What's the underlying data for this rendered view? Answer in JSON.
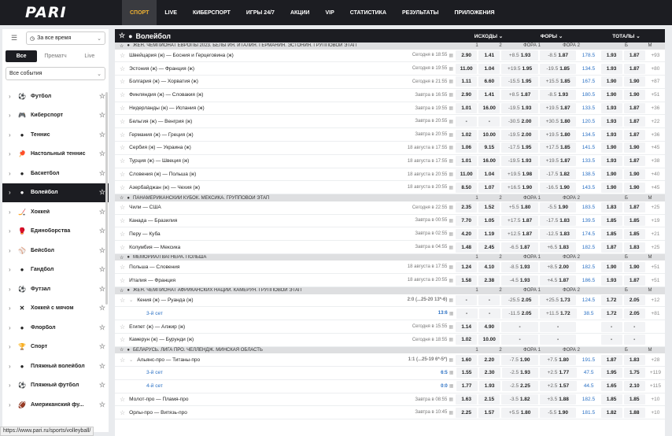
{
  "logo": "PARI",
  "nav": [
    "СПОРТ",
    "LIVE",
    "КИБЕРСПОРТ",
    "ИГРЫ 24/7",
    "АКЦИИ",
    "VIP",
    "СТАТИСТИКА",
    "РЕЗУЛЬТАТЫ",
    "ПРИЛОЖЕНИЯ"
  ],
  "sidebar": {
    "time": "За все время",
    "tabs": [
      "Все",
      "Прематч",
      "Live"
    ],
    "events": "Все события",
    "sports": [
      {
        "name": "Футбол",
        "icon": "⚽"
      },
      {
        "name": "Киберспорт",
        "icon": "🎮"
      },
      {
        "name": "Теннис",
        "icon": "●"
      },
      {
        "name": "Настольный теннис",
        "icon": "🏓"
      },
      {
        "name": "Баскетбол",
        "icon": "●"
      },
      {
        "name": "Волейбол",
        "icon": "●"
      },
      {
        "name": "Хоккей",
        "icon": "🏒"
      },
      {
        "name": "Единоборства",
        "icon": "🥊"
      },
      {
        "name": "Бейсбол",
        "icon": "⚾"
      },
      {
        "name": "Гандбол",
        "icon": "●"
      },
      {
        "name": "Футзал",
        "icon": "⚽"
      },
      {
        "name": "Хоккей с мячом",
        "icon": "✕"
      },
      {
        "name": "Флорбол",
        "icon": "●"
      },
      {
        "name": "Спорт",
        "icon": "🏆"
      },
      {
        "name": "Пляжный волейбол",
        "icon": "●"
      },
      {
        "name": "Пляжный футбол",
        "icon": "⚽"
      },
      {
        "name": "Американский фу...",
        "icon": "🏈"
      }
    ],
    "active": "Волейбол"
  },
  "main": {
    "title": "Волейбол",
    "col_groups": [
      "ИСХОДЫ",
      "ФОРЫ",
      "ТОТАЛЫ"
    ],
    "sub_cols": [
      "1",
      "2",
      "ФОРА 1",
      "ФОРА 2",
      "Б",
      "М"
    ],
    "leagues": [
      {
        "name": "ЖЕН. ЧЕМПИОНАТ ЕВРОПЫ 2023. БЕЛЬГИЯ. ИТАЛИЯ. ГЕРМАНИЯ. ЭСТОНИЯ. ГРУППОВОЙ ЭТАП",
        "rows": [
          {
            "teams": "Швейцария (ж) — Босния и Герцеговина (ж)",
            "time": "Сегодня в 18:55",
            "o1": "2.90",
            "o2": "1.41",
            "f1h": "+8.5",
            "f1": "1.93",
            "f2h": "-8.5",
            "f2": "1.87",
            "th": "178.5",
            "b": "1.93",
            "m": "1.87",
            "more": "+93"
          },
          {
            "teams": "Эстония (ж) — Франция (ж)",
            "time": "Сегодня в 19:55",
            "o1": "11.00",
            "o2": "1.04",
            "f1h": "+19.5",
            "f1": "1.95",
            "f2h": "-19.5",
            "f2": "1.85",
            "th": "134.5",
            "b": "1.93",
            "m": "1.87",
            "more": "+80"
          },
          {
            "teams": "Болгария (ж) — Хорватия (ж)",
            "time": "Сегодня в 21:55",
            "o1": "1.11",
            "o2": "6.60",
            "f1h": "-15.5",
            "f1": "1.95",
            "f2h": "+15.5",
            "f2": "1.85",
            "th": "167.5",
            "b": "1.90",
            "m": "1.90",
            "more": "+87"
          },
          {
            "teams": "Финляндия (ж) — Словакия (ж)",
            "time": "Завтра в 16:55",
            "o1": "2.90",
            "o2": "1.41",
            "f1h": "+8.5",
            "f1": "1.87",
            "f2h": "-8.5",
            "f2": "1.93",
            "th": "180.5",
            "b": "1.90",
            "m": "1.90",
            "more": "+51"
          },
          {
            "teams": "Нидерланды (ж) — Испания (ж)",
            "time": "Завтра в 19:55",
            "o1": "1.01",
            "o2": "16.00",
            "f1h": "-19.5",
            "f1": "1.93",
            "f2h": "+19.5",
            "f2": "1.87",
            "th": "133.5",
            "b": "1.93",
            "m": "1.87",
            "more": "+36"
          },
          {
            "teams": "Бельгия (ж) — Венгрия (ж)",
            "time": "Завтра в 20:55",
            "o1": "-",
            "o2": "-",
            "f1h": "-30.5",
            "f1": "2.00",
            "f2h": "+30.5",
            "f2": "1.80",
            "th": "120.5",
            "b": "1.93",
            "m": "1.87",
            "more": "+22"
          },
          {
            "teams": "Германия (ж) — Греция (ж)",
            "time": "Завтра в 20:55",
            "o1": "1.02",
            "o2": "10.00",
            "f1h": "-19.5",
            "f1": "2.00",
            "f2h": "+19.5",
            "f2": "1.80",
            "th": "134.5",
            "b": "1.93",
            "m": "1.87",
            "more": "+36"
          },
          {
            "teams": "Сербия (ж) — Украина (ж)",
            "time": "18 августа в 17:55",
            "o1": "1.06",
            "o2": "9.15",
            "f1h": "-17.5",
            "f1": "1.95",
            "f2h": "+17.5",
            "f2": "1.85",
            "th": "141.5",
            "b": "1.90",
            "m": "1.90",
            "more": "+45"
          },
          {
            "teams": "Турция (ж) — Швеция (ж)",
            "time": "18 августа в 17:55",
            "o1": "1.01",
            "o2": "16.00",
            "f1h": "-19.5",
            "f1": "1.93",
            "f2h": "+19.5",
            "f2": "1.87",
            "th": "133.5",
            "b": "1.93",
            "m": "1.87",
            "more": "+38"
          },
          {
            "teams": "Словения (ж) — Польша (ж)",
            "time": "18 августа в 20:55",
            "o1": "11.00",
            "o2": "1.04",
            "f1h": "+19.5",
            "f1": "1.98",
            "f2h": "-17.5",
            "f2": "1.82",
            "th": "138.5",
            "b": "1.90",
            "m": "1.90",
            "more": "+40"
          },
          {
            "teams": "Азербайджан (ж) — Чехия (ж)",
            "time": "18 августа в 20:55",
            "o1": "8.50",
            "o2": "1.07",
            "f1h": "+16.5",
            "f1": "1.90",
            "f2h": "-16.5",
            "f2": "1.90",
            "th": "143.5",
            "b": "1.90",
            "m": "1.90",
            "more": "+45"
          }
        ]
      },
      {
        "name": "ПАНАМЕРИКАНСКИЙ КУБОК. МЕКСИКА. ГРУППОВОЙ ЭТАП",
        "rows": [
          {
            "teams": "Чили — США",
            "time": "Сегодня в 22:55",
            "o1": "2.35",
            "o2": "1.52",
            "f1h": "+5.5",
            "f1": "1.80",
            "f2h": "-5.5",
            "f2": "1.90",
            "th": "183.5",
            "b": "1.83",
            "m": "1.87",
            "more": "+25"
          },
          {
            "teams": "Канада — Бразилия",
            "time": "Завтра в 00:55",
            "o1": "7.70",
            "o2": "1.05",
            "f1h": "+17.5",
            "f1": "1.87",
            "f2h": "-17.5",
            "f2": "1.83",
            "th": "139.5",
            "b": "1.85",
            "m": "1.85",
            "more": "+19"
          },
          {
            "teams": "Перу — Куба",
            "time": "Завтра в 02:55",
            "o1": "4.20",
            "o2": "1.19",
            "f1h": "+12.5",
            "f1": "1.87",
            "f2h": "-12.5",
            "f2": "1.83",
            "th": "174.5",
            "b": "1.85",
            "m": "1.85",
            "more": "+21"
          },
          {
            "teams": "Колумбия — Мексика",
            "time": "Завтра в 04:55",
            "o1": "1.48",
            "o2": "2.45",
            "f1h": "-6.5",
            "f1": "1.87",
            "f2h": "+6.5",
            "f2": "1.83",
            "th": "182.5",
            "b": "1.87",
            "m": "1.83",
            "more": "+25"
          }
        ]
      },
      {
        "name": "МЕМОРИАЛ ВАГНЕРА. ПОЛЬША",
        "rows": [
          {
            "teams": "Польша — Словения",
            "time": "18 августа в 17:55",
            "o1": "1.24",
            "o2": "4.10",
            "f1h": "-8.5",
            "f1": "1.93",
            "f2h": "+8.5",
            "f2": "2.00",
            "th": "182.5",
            "b": "1.90",
            "m": "1.90",
            "more": "+51"
          },
          {
            "teams": "Италия — Франция",
            "time": "18 августа в 20:55",
            "o1": "1.58",
            "o2": "2.38",
            "f1h": "-4.5",
            "f1": "1.93",
            "f2h": "+4.5",
            "f2": "1.87",
            "th": "186.5",
            "b": "1.93",
            "m": "1.87",
            "more": "+51"
          }
        ]
      },
      {
        "name": "ЖЕН. ЧЕМПИОНАТ АФРИКАНСКИХ НАЦИЙ. КАМЕРУН. ГРУППОВОЙ ЭТАП",
        "rows": [
          {
            "teams": "Кения (ж) — Руанда (ж)",
            "time": "2:0 (...25-20 13*-6)",
            "o1": "-",
            "o2": "-",
            "f1h": "-25.5",
            "f1": "2.05",
            "f2h": "+25.5",
            "f2": "1.73",
            "th": "124.5",
            "b": "1.72",
            "m": "2.05",
            "more": "+12",
            "live": true
          },
          {
            "teams": "3-й сет",
            "time": "13:6",
            "o1": "-",
            "o2": "-",
            "f1h": "-11.5",
            "f1": "2.05",
            "f2h": "+11.5",
            "f2": "1.72",
            "th": "38.5",
            "b": "1.72",
            "m": "2.05",
            "more": "+81",
            "sub": true
          },
          {
            "teams": "Египет (ж) — Алжир (ж)",
            "time": "Сегодня в 15:55",
            "o1": "1.14",
            "o2": "4.90",
            "f1h": "",
            "f1": "-",
            "f2h": "",
            "f2": "-",
            "th": "",
            "b": "-",
            "m": "-",
            "more": ""
          },
          {
            "teams": "Камерун (ж) — Бурунди (ж)",
            "time": "Сегодня в 18:55",
            "o1": "1.02",
            "o2": "10.00",
            "f1h": "",
            "f1": "-",
            "f2h": "",
            "f2": "-",
            "th": "",
            "b": "-",
            "m": "-",
            "more": ""
          }
        ]
      },
      {
        "name": "БЕЛАРУСЬ. ЛИГА ПРО. ЧЕЛЛЕНДЖ. МИНСКАЯ ОБЛАСТЬ",
        "rows": [
          {
            "teams": "Альянс-про — Титаны-про",
            "time": "1:1 (...25-19 6*-5*)",
            "o1": "1.60",
            "o2": "2.20",
            "f1h": "-7.5",
            "f1": "1.90",
            "f2h": "+7.5",
            "f2": "1.80",
            "th": "191.5",
            "b": "1.87",
            "m": "1.83",
            "more": "+28",
            "live": true
          },
          {
            "teams": "3-й сет",
            "time": "6:5",
            "o1": "1.55",
            "o2": "2.30",
            "f1h": "-2.5",
            "f1": "1.93",
            "f2h": "+2.5",
            "f2": "1.77",
            "th": "47.5",
            "b": "1.95",
            "m": "1.75",
            "more": "+119",
            "sub": true
          },
          {
            "teams": "4-й сет",
            "time": "0:0",
            "o1": "1.77",
            "o2": "1.93",
            "f1h": "-2.5",
            "f1": "2.25",
            "f2h": "+2.5",
            "f2": "1.57",
            "th": "44.5",
            "b": "1.65",
            "m": "2.10",
            "more": "+115",
            "sub": true
          },
          {
            "teams": "Молот-про — Пламя-про",
            "time": "Завтра в 08:55",
            "o1": "1.63",
            "o2": "2.15",
            "f1h": "-3.5",
            "f1": "1.82",
            "f2h": "+3.5",
            "f2": "1.88",
            "th": "182.5",
            "b": "1.85",
            "m": "1.85",
            "more": "+10"
          },
          {
            "teams": "Орлы-про — Витязь-про",
            "time": "Завтра в 10:45",
            "o1": "2.25",
            "o2": "1.57",
            "f1h": "+5.5",
            "f1": "1.80",
            "f2h": "-5.5",
            "f2": "1.90",
            "th": "181.5",
            "b": "1.82",
            "m": "1.88",
            "more": "+10"
          }
        ]
      }
    ]
  },
  "status_url": "https://www.pari.ru/sports/volleyball/"
}
